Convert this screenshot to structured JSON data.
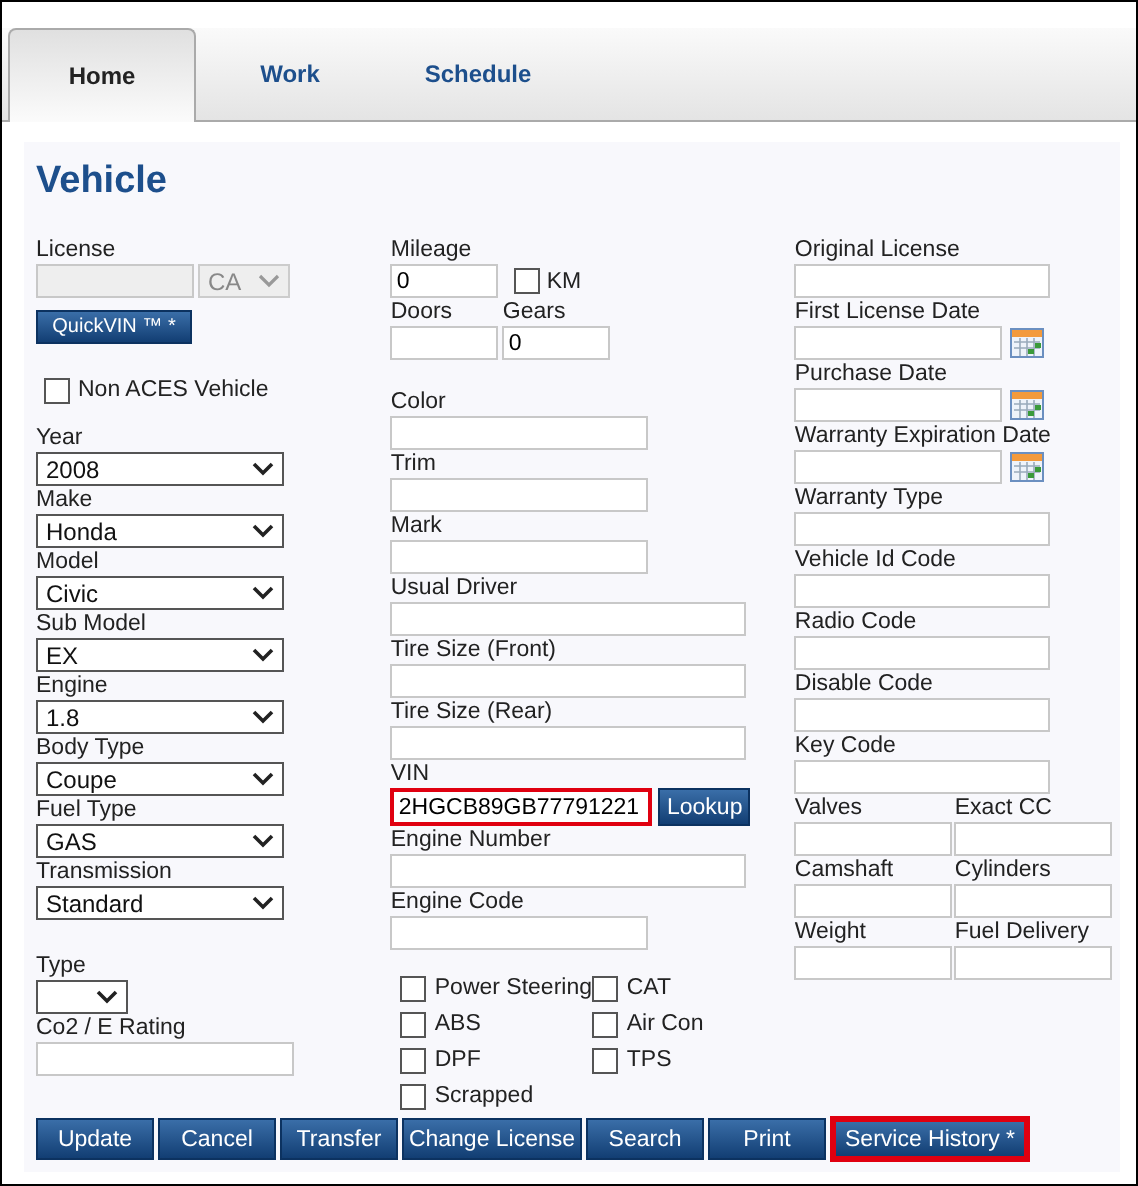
{
  "tabs": [
    {
      "label": "Home",
      "selected": true
    },
    {
      "label": "Work",
      "selected": false
    },
    {
      "label": "Schedule",
      "selected": false
    }
  ],
  "title": "Vehicle",
  "license": {
    "label": "License",
    "state": "CA",
    "disabled": true
  },
  "quickvin_button": "QuickVIN ™ *",
  "non_aces": {
    "label": "Non ACES Vehicle",
    "checked": false
  },
  "selects": [
    {
      "label": "Year",
      "value": "2008"
    },
    {
      "label": "Make",
      "value": "Honda"
    },
    {
      "label": "Model",
      "value": "Civic"
    },
    {
      "label": "Sub Model",
      "value": "EX"
    },
    {
      "label": "Engine",
      "value": "1.8"
    },
    {
      "label": "Body Type",
      "value": "Coupe"
    },
    {
      "label": "Fuel Type",
      "value": "GAS"
    },
    {
      "label": "Transmission",
      "value": "Standard"
    }
  ],
  "type_select": {
    "label": "Type"
  },
  "co2": {
    "label": "Co2 / E Rating"
  },
  "mileage": {
    "label": "Mileage",
    "value": "0"
  },
  "km": {
    "label": "KM",
    "checked": false
  },
  "doors": {
    "label": "Doors"
  },
  "gears": {
    "label": "Gears",
    "value": "0"
  },
  "middle_fields": [
    {
      "label": "Color",
      "kind": "short"
    },
    {
      "label": "Trim",
      "kind": "short"
    },
    {
      "label": "Mark",
      "kind": "short"
    },
    {
      "label": "Usual Driver",
      "kind": "long"
    },
    {
      "label": "Tire Size (Front)",
      "kind": "long"
    },
    {
      "label": "Tire Size (Rear)",
      "kind": "long"
    }
  ],
  "vin": {
    "label": "VIN",
    "value": "2HGCB89GB77791221",
    "highlighted": true
  },
  "lookup_button": "Lookup",
  "engine_fields": [
    {
      "label": "Engine Number",
      "kind": "long"
    },
    {
      "label": "Engine Code",
      "kind": "short"
    }
  ],
  "options": [
    {
      "label": "Power Steering",
      "checked": false
    },
    {
      "label": "CAT",
      "checked": false
    },
    {
      "label": "ABS",
      "checked": false
    },
    {
      "label": "Air Con",
      "checked": false
    },
    {
      "label": "DPF",
      "checked": false
    },
    {
      "label": "TPS",
      "checked": false
    },
    {
      "label": "Scrapped",
      "checked": false
    }
  ],
  "right_fields": [
    {
      "label": "Original License",
      "kind": "text"
    },
    {
      "label": "First License Date",
      "kind": "date"
    },
    {
      "label": "Purchase Date",
      "kind": "date"
    },
    {
      "label": "Warranty Expiration Date",
      "kind": "date"
    },
    {
      "label": "Warranty Type",
      "kind": "text"
    },
    {
      "label": "Vehicle Id Code",
      "kind": "text"
    },
    {
      "label": "Radio Code",
      "kind": "text"
    },
    {
      "label": "Disable Code",
      "kind": "text"
    },
    {
      "label": "Key Code",
      "kind": "text"
    }
  ],
  "pairs": [
    [
      "Valves",
      "Exact CC"
    ],
    [
      "Camshaft",
      "Cylinders"
    ],
    [
      "Weight",
      "Fuel Delivery"
    ]
  ],
  "buttons": [
    {
      "label": "Update",
      "highlighted": false
    },
    {
      "label": "Cancel",
      "highlighted": false
    },
    {
      "label": "Transfer",
      "highlighted": false
    },
    {
      "label": "Change License",
      "highlighted": false
    },
    {
      "label": "Search",
      "highlighted": false
    },
    {
      "label": "Print",
      "highlighted": false
    },
    {
      "label": "Service History *",
      "highlighted": true
    }
  ]
}
